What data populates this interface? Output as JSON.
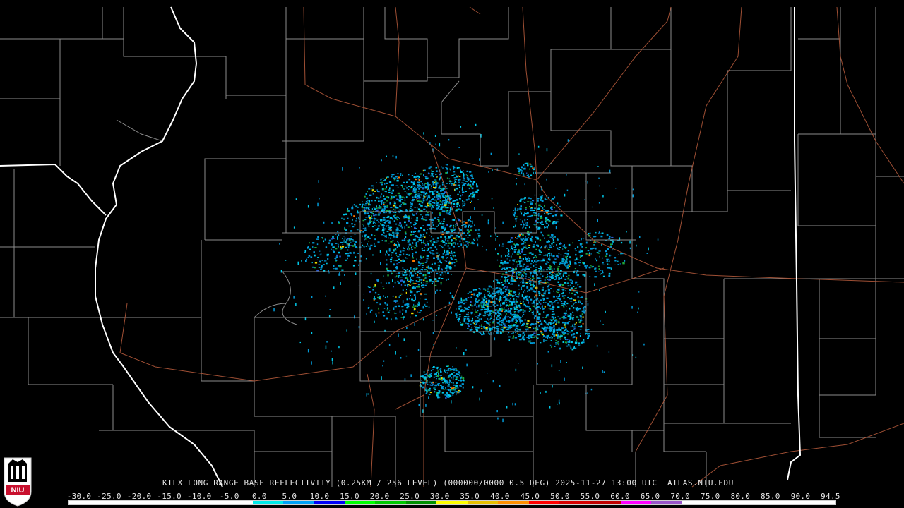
{
  "title": "KILX LONG RANGE BASE REFLECTIVITY (0.25KM / 256 LEVEL) (000000/0000 0.5 DEG) 2025-11-27 13:00 UTC  ATLAS.NIU.EDU",
  "logo_text": "NIU",
  "scale": {
    "labels": [
      "-30.0",
      "-25.0",
      "-20.0",
      "-15.0",
      "-10.0",
      "-5.0",
      "0.0",
      "5.0",
      "10.0",
      "15.0",
      "20.0",
      "25.0",
      "30.0",
      "35.0",
      "40.0",
      "45.0",
      "50.0",
      "55.0",
      "60.0",
      "65.0",
      "70.0",
      "75.0",
      "80.0",
      "85.0",
      "90.0",
      "94.5"
    ],
    "colors": [
      "#ffffff",
      "#ffffff",
      "#ffffff",
      "#ffffff",
      "#ffffff",
      "#ffffff",
      "#00e8e8",
      "#00a0f6",
      "#0000f6",
      "#00ff00",
      "#00c800",
      "#009000",
      "#ffff00",
      "#e7c000",
      "#ff9000",
      "#ff0000",
      "#d60000",
      "#c00000",
      "#ff00ff",
      "#9955c9",
      "#ffffff",
      "#ffffff",
      "#ffffff",
      "#ffffff",
      "#ffffff"
    ]
  },
  "map": {
    "background": "#000000",
    "county_color": "#8c8c8c",
    "state_color": "#ffffff",
    "road_color": "#b0583a"
  }
}
